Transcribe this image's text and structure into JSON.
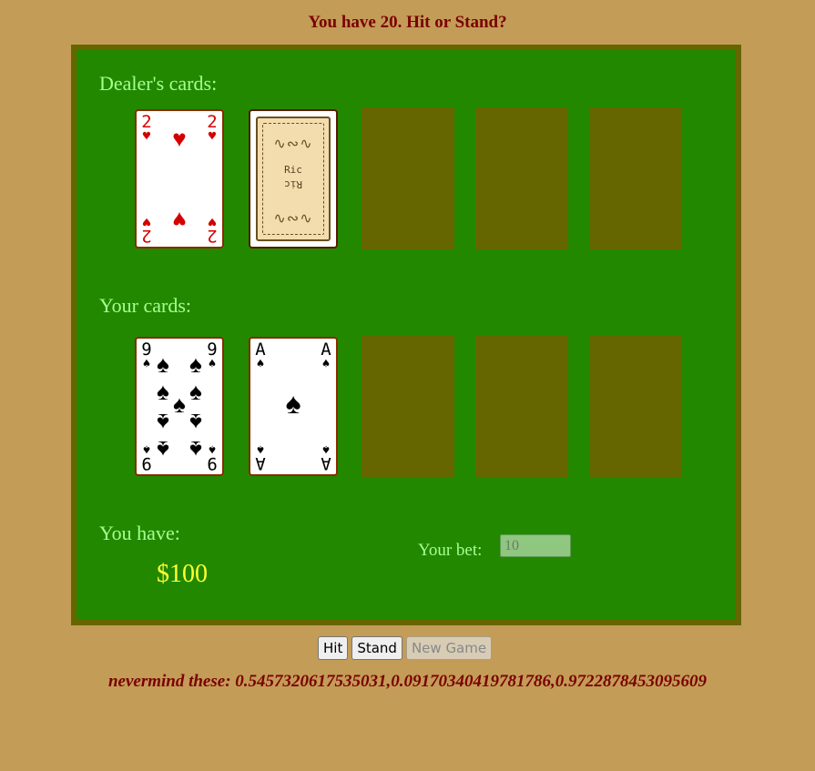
{
  "status_message": "You have 20. Hit or Stand?",
  "dealer": {
    "label": "Dealer's cards:",
    "cards": [
      {
        "rank": "2",
        "suit": "♥",
        "color": "#d40000",
        "face_up": true
      },
      {
        "face_up": false,
        "back_logo": "Ric"
      }
    ]
  },
  "player": {
    "label": "Your cards:",
    "cards": [
      {
        "rank": "9",
        "suit": "♠",
        "color": "#000000",
        "face_up": true
      },
      {
        "rank": "A",
        "suit": "♠",
        "color": "#000000",
        "face_up": true
      }
    ]
  },
  "bankroll": {
    "label": "You have:",
    "amount": "$100"
  },
  "bet": {
    "label": "Your bet:",
    "value": "10"
  },
  "buttons": {
    "hit": "Hit",
    "stand": "Stand",
    "new_game": "New Game"
  },
  "footer_text": "nevermind these: 0.5457320617535031,0.09170340419781786,0.9722878453095609",
  "colors": {
    "background": "#c39c58",
    "table": "#228800",
    "table_border": "#666600",
    "empty_slot": "#666600",
    "label": "#a6ff90",
    "money": "#ffff33",
    "status_text": "#7a0000"
  }
}
